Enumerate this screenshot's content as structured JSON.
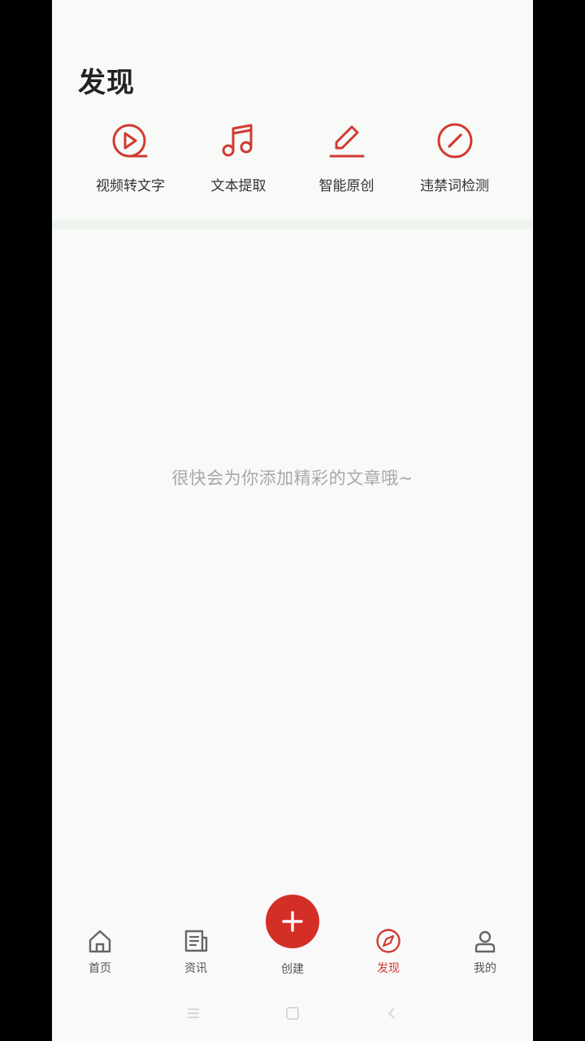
{
  "header": {
    "title": "发现"
  },
  "tools": [
    {
      "label": "视频转文字",
      "icon": "play-circle-icon"
    },
    {
      "label": "文本提取",
      "icon": "music-note-icon"
    },
    {
      "label": "智能原创",
      "icon": "pen-icon"
    },
    {
      "label": "违禁词检测",
      "icon": "forbidden-icon"
    }
  ],
  "main": {
    "empty_message": "很快会为你添加精彩的文章哦~"
  },
  "tabbar": {
    "home_label": "首页",
    "news_label": "资讯",
    "create_label": "创建",
    "discover_label": "发现",
    "mine_label": "我的",
    "active_tab": "发现"
  },
  "colors": {
    "accent": "#d23a32",
    "text_primary": "#222222",
    "text_muted": "#a8a8a8"
  }
}
